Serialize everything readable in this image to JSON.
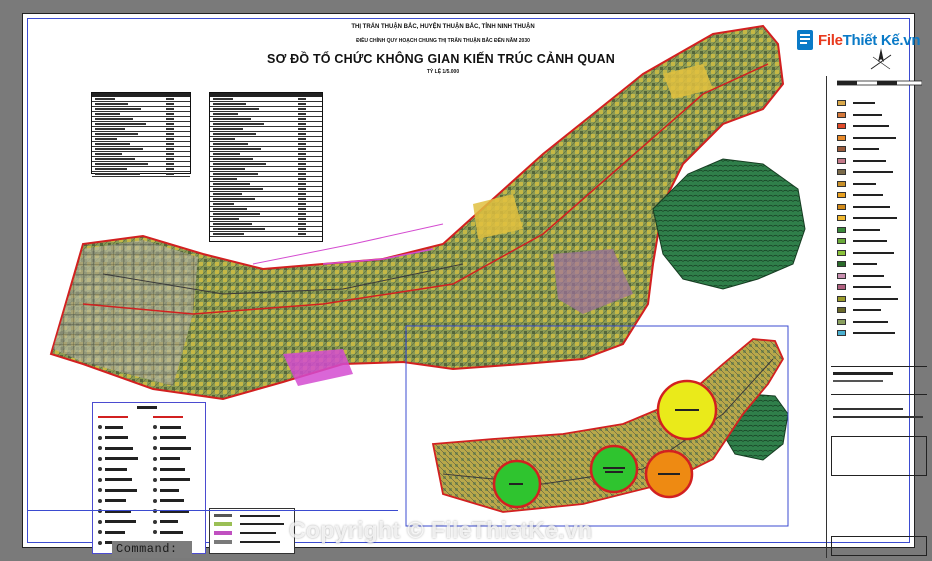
{
  "drawing": {
    "header_line1": "THỊ TRẤN THUẬN BẮC, HUYỆN THUẬN BẮC, TỈNH NINH THUẬN",
    "header_line2": "ĐIỀU CHỈNH QUY HOẠCH CHUNG THỊ TRẤN THUẬN BẮC ĐẾN NĂM 2030",
    "title": "SƠ ĐỒ TỔ CHỨC KHÔNG GIAN KIẾN TRÚC CẢNH QUAN",
    "scale": "TỶ LỆ 1/5.000"
  },
  "branding": {
    "logo_prefix": "File",
    "logo_main": "Thiết Kế",
    "logo_suffix": ".vn",
    "watermark": "Copyright © FileThietKe.vn"
  },
  "command_line": {
    "label": "Command:"
  },
  "colors": {
    "sheet_bg": "#ffffff",
    "viewport_bg": "#7a7a7a",
    "frame_blue": "#3b4bd0",
    "urban_green": "#8e9b5a",
    "urban_yellow": "#c9b640",
    "hill_green": "#2f7f4a",
    "road_red": "#d22020",
    "zone_magenta": "#d44bd0",
    "circle_green": "#2fc42f",
    "circle_yellow": "#eaea1a",
    "circle_orange": "#ee8a12"
  },
  "legend_swatches": [
    "#d9a84a",
    "#d4783a",
    "#e04a2a",
    "#e88a2a",
    "#9a5a3a",
    "#c47a8a",
    "#7a6a4a",
    "#c8902a",
    "#e8a020",
    "#d28a1a",
    "#f0b830",
    "#3a8a3a",
    "#6aaa3a",
    "#8ac23a",
    "#2a6a2a",
    "#c890b0",
    "#b06080",
    "#9a9a2a",
    "#6a6a2a",
    "#8aa060",
    "#4ab0d0"
  ],
  "icons": {
    "compass": "north-arrow-icon",
    "logo_mark": "logo-mark-icon"
  }
}
